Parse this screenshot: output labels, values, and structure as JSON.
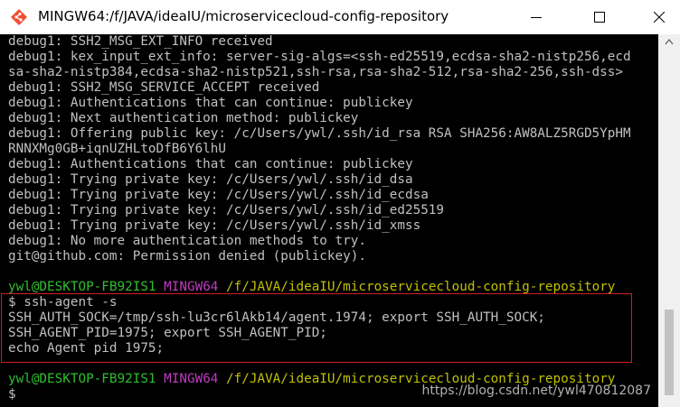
{
  "window": {
    "title": "MINGW64:/f/JAVA/ideaIU/microservicecloud-config-repository"
  },
  "terminal": {
    "log_lines": [
      "debug1: SSH2_MSG_EXT_INFO received",
      "debug1: kex_input_ext_info: server-sig-algs=<ssh-ed25519,ecdsa-sha2-nistp256,ecd",
      "sa-sha2-nistp384,ecdsa-sha2-nistp521,ssh-rsa,rsa-sha2-512,rsa-sha2-256,ssh-dss>",
      "debug1: SSH2_MSG_SERVICE_ACCEPT received",
      "debug1: Authentications that can continue: publickey",
      "debug1: Next authentication method: publickey",
      "debug1: Offering public key: /c/Users/ywl/.ssh/id_rsa RSA SHA256:AW8ALZ5RGD5YpHM",
      "RNNXMg0GB+iqnUZHLtoDfB6Y6lhU",
      "debug1: Authentications that can continue: publickey",
      "debug1: Trying private key: /c/Users/ywl/.ssh/id_dsa",
      "debug1: Trying private key: /c/Users/ywl/.ssh/id_ecdsa",
      "debug1: Trying private key: /c/Users/ywl/.ssh/id_ed25519",
      "debug1: Trying private key: /c/Users/ywl/.ssh/id_xmss",
      "debug1: No more authentication methods to try.",
      "git@github.com: Permission denied (publickey)."
    ],
    "prompt1": {
      "user_host": "ywl@DESKTOP-FB92IS1",
      "shell": "MINGW64",
      "path": "/f/JAVA/ideaIU/microservicecloud-config-repository"
    },
    "command": "$ ssh-agent -s",
    "output_lines": [
      "SSH_AUTH_SOCK=/tmp/ssh-lu3cr6lAkb14/agent.1974; export SSH_AUTH_SOCK;",
      "SSH_AGENT_PID=1975; export SSH_AGENT_PID;",
      "echo Agent pid 1975;"
    ],
    "prompt2": {
      "user_host": "ywl@DESKTOP-FB92IS1",
      "shell": "MINGW64",
      "path": "/f/JAVA/ideaIU/microservicecloud-config-repository"
    },
    "final_prompt": "$"
  },
  "watermark": "https://blog.csdn.net/ywl470812087",
  "colors": {
    "background": "#000000",
    "text": "#c0c0c0",
    "user_host": "#2fbf2f",
    "shell": "#c03ac0",
    "path": "#c0c000",
    "highlight_box": "#d02020"
  },
  "icons": {
    "app": "git-bash-diamond-icon",
    "minimize": "minimize-icon",
    "maximize": "maximize-icon",
    "close": "close-icon",
    "scroll_up": "scroll-up-arrow-icon"
  }
}
